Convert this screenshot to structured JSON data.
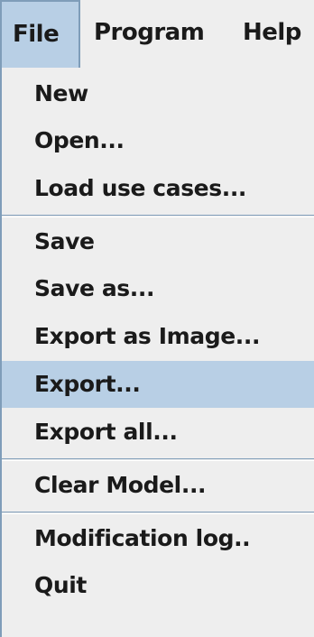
{
  "menubar": {
    "file_label": "File",
    "program_label": "Program",
    "help_label": "Help"
  },
  "file_menu": {
    "items": [
      {
        "label": "New"
      },
      {
        "label": "Open..."
      },
      {
        "label": "Load use cases..."
      },
      {
        "label": "Save"
      },
      {
        "label": "Save as..."
      },
      {
        "label": "Export as Image..."
      },
      {
        "label": "Export...",
        "selected": true
      },
      {
        "label": "Export all..."
      },
      {
        "label": "Clear Model..."
      },
      {
        "label": "Modification log.."
      },
      {
        "label": "Quit"
      }
    ]
  },
  "colors": {
    "menu_background": "#eeeeee",
    "selection_background": "#b8cfe5",
    "border": "#7f9db9",
    "text": "#1a1a1a"
  }
}
